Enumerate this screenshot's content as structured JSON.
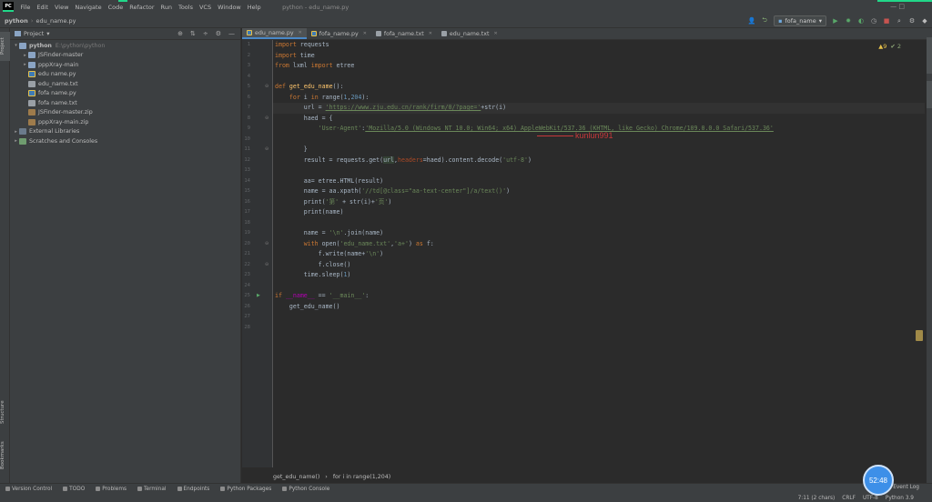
{
  "window": {
    "logo_text": "PC",
    "menus": [
      "File",
      "Edit",
      "View",
      "Navigate",
      "Code",
      "Refactor",
      "Run",
      "Tools",
      "VCS",
      "Window",
      "Help"
    ],
    "title": "python - edu_name.py",
    "controls": "—   □"
  },
  "navbar": {
    "project": "python",
    "file": "edu_name.py",
    "run_config": "fofa_name"
  },
  "left_strip": {
    "project": "Project",
    "structure": "Structure",
    "bookmarks": "Bookmarks"
  },
  "project_panel": {
    "title": "Project",
    "items": [
      {
        "label": "python",
        "hint": "E:\\python\\python",
        "indent": 0,
        "arrow": "▾",
        "icon": "folder",
        "bold": true
      },
      {
        "label": "JSFinder-master",
        "hint": "",
        "indent": 1,
        "arrow": "▸",
        "icon": "folder"
      },
      {
        "label": "pppXray-main",
        "hint": "",
        "indent": 1,
        "arrow": "▸",
        "icon": "folder"
      },
      {
        "label": "edu name.py",
        "hint": "",
        "indent": 1,
        "arrow": "",
        "icon": "py"
      },
      {
        "label": "edu_name.txt",
        "hint": "",
        "indent": 1,
        "arrow": "",
        "icon": "txt"
      },
      {
        "label": "fofa name.py",
        "hint": "",
        "indent": 1,
        "arrow": "",
        "icon": "py"
      },
      {
        "label": "fofa name.txt",
        "hint": "",
        "indent": 1,
        "arrow": "",
        "icon": "txt"
      },
      {
        "label": "JSFinder-master.zip",
        "hint": "",
        "indent": 1,
        "arrow": "",
        "icon": "zip"
      },
      {
        "label": "pppXray-main.zip",
        "hint": "",
        "indent": 1,
        "arrow": "",
        "icon": "zip"
      },
      {
        "label": "External Libraries",
        "hint": "",
        "indent": 0,
        "arrow": "▸",
        "icon": "lib"
      },
      {
        "label": "Scratches and Consoles",
        "hint": "",
        "indent": 0,
        "arrow": "▸",
        "icon": "scratch"
      }
    ]
  },
  "tabs": [
    {
      "label": "edu_name.py",
      "active": true,
      "icon": "py"
    },
    {
      "label": "fofa_name.py",
      "active": false,
      "icon": "py"
    },
    {
      "label": "fofa_name.txt",
      "active": false,
      "icon": "txt"
    },
    {
      "label": "edu_name.txt",
      "active": false,
      "icon": "txt"
    }
  ],
  "inspections": {
    "warnings": "▲9",
    "ok": "✔ 2"
  },
  "code_lines": [
    "<span class='kw'>import</span> requests",
    "<span class='kw'>import</span> time",
    "<span class='kw'>from</span> lxml <span class='kw'>import</span> etree",
    "",
    "<span class='kw'>def</span> <span class='fn'>get_edu_name</span>():",
    "    <span class='kw'>for</span> i <span class='kw'>in</span> range(<span class='num'>1</span>,<span class='num'>204</span>):",
    "        url = <span class='url'>'https://www.zju.edu.cn/rank/firm/0/?page='</span>+str(i)",
    "        haed = {",
    "            <span class='str'>'User-Agent'</span>:<span class='url'>'Mozilla/5.0 (Windows NT 10.0; Win64; x64) AppleWebKit/537.36 (KHTML, like Gecko) Chrome/109.0.0.0 Safari/537.36'</span>",
    "",
    "        }",
    "        result = requests.get(<span class='param-hl'>url</span>,<span class='param'>headers</span>=haed).content.decode(<span class='str'>'utf-8'</span>)",
    "",
    "        aa= etree.HTML(result)",
    "        name = aa.xpath(<span class='str'>'//td[@class=\"aa-text-center\"]/a/text()'</span>)",
    "        print(<span class='str'>'第'</span> + str(i)+<span class='str'>'页'</span>)",
    "        print(name)",
    "",
    "        name = <span class='str'>'\\n'</span>.join(name)",
    "        <span class='kw'>with</span> open(<span class='str'>'edu_name.txt'</span>,<span class='str'>'a+'</span>) <span class='kw'>as</span> f:",
    "            f.write(name+<span class='str'>'\\n'</span>)",
    "            f.close()",
    "        time.sleep(<span class='num'>1</span>)",
    "",
    "<span class='kw'>if</span> <span class='dunder'>__name__</span> == <span class='str'>'__main__'</span>:",
    "    get_edu_name()",
    "",
    ""
  ],
  "line_numbers": [
    "1",
    "2",
    "3",
    "4",
    "5",
    "6",
    "7",
    "8",
    "9",
    "10",
    "11",
    "12",
    "13",
    "14",
    "15",
    "16",
    "17",
    "18",
    "19",
    "20",
    "21",
    "22",
    "23",
    "24",
    "25",
    "26",
    "27",
    "28"
  ],
  "watermark": "kunlun991",
  "breadcrumb": {
    "func": "get_edu_name()",
    "sep": "›",
    "loop": "for i in range(1,204)"
  },
  "bottom_tools": [
    "Version Control",
    "TODO",
    "Problems",
    "Terminal",
    "Endpoints",
    "Python Packages",
    "Python Console"
  ],
  "event_log": "Event Log",
  "status": {
    "position": "7:11 (2 chars)",
    "line_sep": "CRLF",
    "encoding": "UTF-8",
    "interpreter": "Python 3.9"
  },
  "timer": "52:48",
  "colors": {
    "accent": "#4a88c7",
    "keyword": "#cc7832",
    "string": "#6a8759",
    "watermark": "#c8383a",
    "timer": "#3d8fe8"
  }
}
